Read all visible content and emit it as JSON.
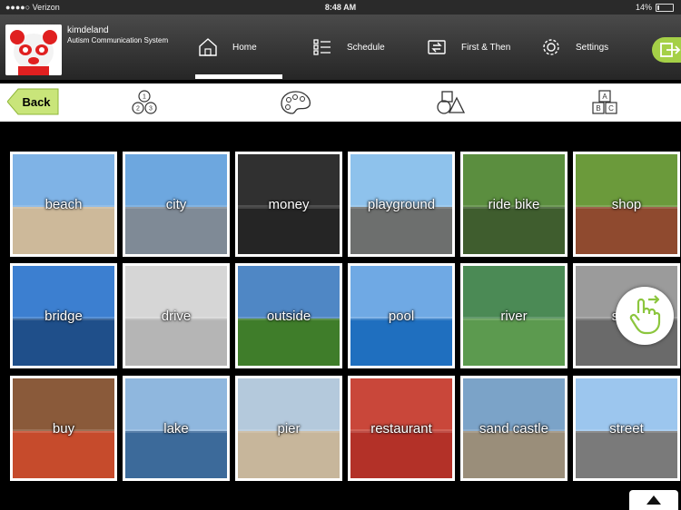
{
  "status": {
    "carrier": "●●●●○ Verizon",
    "time": "8:48 AM",
    "battery": "14%"
  },
  "user": {
    "name": "kimdeland",
    "subtitle": "Autism Communication System"
  },
  "nav": [
    {
      "label": "Home",
      "icon": "home-icon"
    },
    {
      "label": "Schedule",
      "icon": "list-icon"
    },
    {
      "label": "First & Then",
      "icon": "swap-icon"
    },
    {
      "label": "Settings",
      "icon": "gear-icon"
    }
  ],
  "toolbar": {
    "back_label": "Back"
  },
  "colors": {
    "accent": "#a5d047",
    "header_bg": "#333333",
    "tile_border": "#ffffff"
  },
  "tiles": [
    {
      "label": "beach",
      "sky": "#7fb3e6",
      "ground": "#cdb99a"
    },
    {
      "label": "city",
      "sky": "#6da7df",
      "ground": "#7f8a96"
    },
    {
      "label": "money",
      "sky": "#303030",
      "ground": "#252525"
    },
    {
      "label": "playground",
      "sky": "#8ec2ec",
      "ground": "#6d6f6e"
    },
    {
      "label": "ride bike",
      "sky": "#5b8e3f",
      "ground": "#3f5d2e"
    },
    {
      "label": "shop",
      "sky": "#6b9a3b",
      "ground": "#8f4a2f"
    },
    {
      "label": "bridge",
      "sky": "#3c7fd0",
      "ground": "#1f4f8a"
    },
    {
      "label": "drive",
      "sky": "#d6d6d6",
      "ground": "#b5b5b5"
    },
    {
      "label": "outside",
      "sky": "#4f87c5",
      "ground": "#3f7d2a"
    },
    {
      "label": "pool",
      "sky": "#6fa9e4",
      "ground": "#1f6fbf"
    },
    {
      "label": "river",
      "sky": "#4b8a55",
      "ground": "#5c9a4f"
    },
    {
      "label": "shop",
      "sky": "#9b9b9b",
      "ground": "#6a6a6a"
    },
    {
      "label": "buy",
      "sky": "#8a5a3a",
      "ground": "#c64b2c"
    },
    {
      "label": "lake",
      "sky": "#8fb7de",
      "ground": "#3c6a9a"
    },
    {
      "label": "pier",
      "sky": "#b4c9dc",
      "ground": "#c7b69b"
    },
    {
      "label": "restaurant",
      "sky": "#c9473a",
      "ground": "#b33128"
    },
    {
      "label": "sand castle",
      "sky": "#7ba3c8",
      "ground": "#9a8e7a"
    },
    {
      "label": "street",
      "sky": "#9cc6ee",
      "ground": "#7a7a7a"
    }
  ]
}
